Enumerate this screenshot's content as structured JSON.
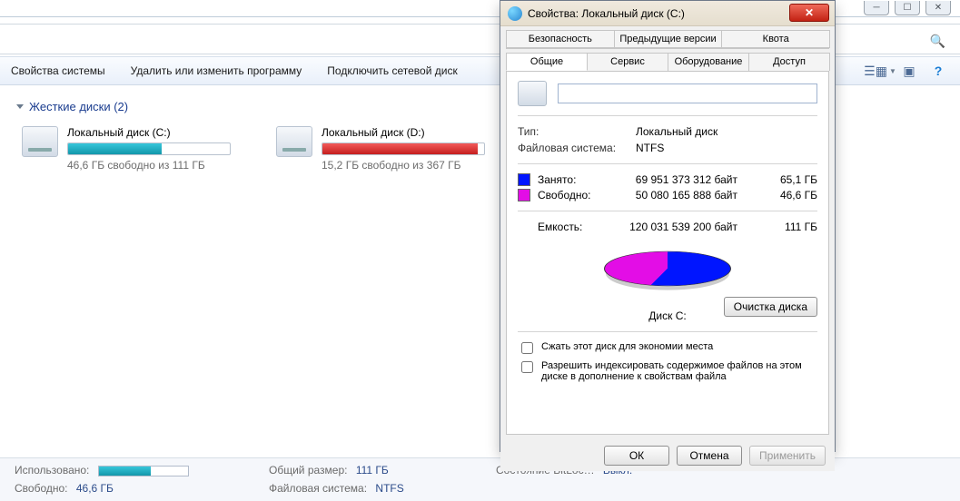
{
  "parent_window": {
    "min_glyph": "─",
    "max_glyph": "☐",
    "close_glyph": "✕"
  },
  "toolbar": {
    "items": [
      "Свойства системы",
      "Удалить или изменить программу",
      "Подключить сетевой диск"
    ],
    "icons": {
      "view": "☰▦",
      "pane": "▣",
      "help": "?"
    }
  },
  "group": {
    "header": "Жесткие диски (2)"
  },
  "drives": [
    {
      "name": "Локальный диск (C:)",
      "free_text": "46,6 ГБ свободно из 111 ГБ",
      "fill_pct": 58,
      "fill_class": ""
    },
    {
      "name": "Локальный диск (D:)",
      "free_text": "15,2 ГБ свободно из 367 ГБ",
      "fill_pct": 96,
      "fill_class": "red"
    }
  ],
  "status": {
    "used_label": "Использовано:",
    "used_bar_pct": 58,
    "size_label": "Общий размер:",
    "size_value": "111 ГБ",
    "bitlocker_label": "Состояние BitLoc…",
    "bitlocker_value": "Выкл.",
    "free_label": "Свободно:",
    "free_value": "46,6 ГБ",
    "fs_label": "Файловая система:",
    "fs_value": "NTFS"
  },
  "dialog": {
    "title": "Свойства: Локальный диск (C:)",
    "close_glyph": "✕",
    "tabs_back": [
      "Безопасность",
      "Предыдущие версии",
      "Квота"
    ],
    "tabs_front": [
      "Общие",
      "Сервис",
      "Оборудование",
      "Доступ"
    ],
    "active_tab": "Общие",
    "volume_label": "",
    "type_label": "Тип:",
    "type_value": "Локальный диск",
    "fs_label": "Файловая система:",
    "fs_value": "NTFS",
    "used_label": "Занято:",
    "used_bytes": "69 951 373 312 байт",
    "used_gb": "65,1 ГБ",
    "free_label": "Свободно:",
    "free_bytes": "50 080 165 888 байт",
    "free_gb": "46,6 ГБ",
    "cap_label": "Емкость:",
    "cap_bytes": "120 031 539 200 байт",
    "cap_gb": "111 ГБ",
    "pie_label": "Диск C:",
    "cleanup_btn": "Очистка диска",
    "compress_cb": "Сжать этот диск для экономии места",
    "index_cb": "Разрешить индексировать содержимое файлов на этом диске в дополнение к свойствам файла",
    "ok": "ОК",
    "cancel": "Отмена",
    "apply": "Применить"
  },
  "chart_data": {
    "type": "pie",
    "title": "Диск C:",
    "series": [
      {
        "name": "Занято",
        "value_bytes": 69951373312,
        "value_gb": 65.1,
        "color": "#0015ff"
      },
      {
        "name": "Свободно",
        "value_bytes": 50080165888,
        "value_gb": 46.6,
        "color": "#e30de6"
      }
    ],
    "total_bytes": 120031539200,
    "total_gb": 111
  }
}
